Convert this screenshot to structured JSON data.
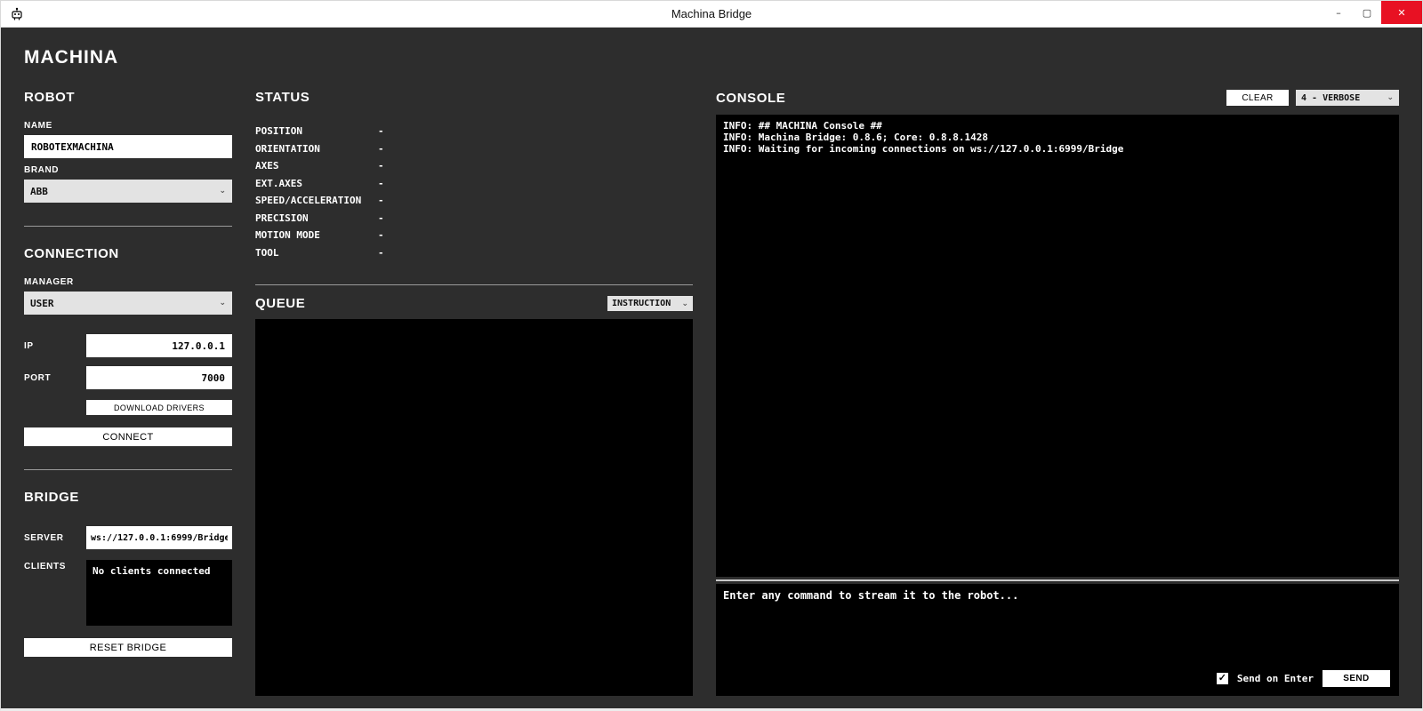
{
  "window": {
    "title": "Machina Bridge",
    "app_heading": "MACHINA"
  },
  "icons": {
    "minimize": "–",
    "maximize": "▢",
    "close": "✕",
    "chevron_down": "⌄",
    "check": "✓"
  },
  "robot": {
    "heading": "ROBOT",
    "name_label": "NAME",
    "name_value": "ROBOTEXMACHINA",
    "brand_label": "BRAND",
    "brand_value": "ABB"
  },
  "connection": {
    "heading": "CONNECTION",
    "manager_label": "MANAGER",
    "manager_value": "USER",
    "ip_label": "IP",
    "ip_value": "127.0.0.1",
    "port_label": "PORT",
    "port_value": "7000",
    "download_drivers_label": "DOWNLOAD DRIVERS",
    "connect_label": "CONNECT"
  },
  "bridge": {
    "heading": "BRIDGE",
    "server_label": "SERVER",
    "server_value": "ws://127.0.0.1:6999/Bridge",
    "clients_label": "CLIENTS",
    "clients_value": "No clients connected",
    "reset_label": "RESET BRIDGE"
  },
  "status": {
    "heading": "STATUS",
    "rows": [
      {
        "label": "POSITION",
        "value": "-"
      },
      {
        "label": "ORIENTATION",
        "value": "-"
      },
      {
        "label": "AXES",
        "value": "-"
      },
      {
        "label": "EXT.AXES",
        "value": "-"
      },
      {
        "label": "SPEED/ACCELERATION",
        "value": "-"
      },
      {
        "label": "PRECISION",
        "value": "-"
      },
      {
        "label": "MOTION MODE",
        "value": "-"
      },
      {
        "label": "TOOL",
        "value": "-"
      }
    ]
  },
  "queue": {
    "heading": "QUEUE",
    "mode_value": "INSTRUCTION"
  },
  "console": {
    "heading": "CONSOLE",
    "clear_label": "CLEAR",
    "verbosity_value": "4 - VERBOSE",
    "lines": [
      "INFO: ## MACHINA Console ##",
      "INFO: Machina Bridge: 0.8.6; Core: 0.8.8.1428",
      "INFO: Waiting for incoming connections on ws://127.0.0.1:6999/Bridge"
    ],
    "input_hint": "Enter any command to stream it to the robot...",
    "send_on_enter_label": "Send on Enter",
    "send_label": "SEND"
  }
}
